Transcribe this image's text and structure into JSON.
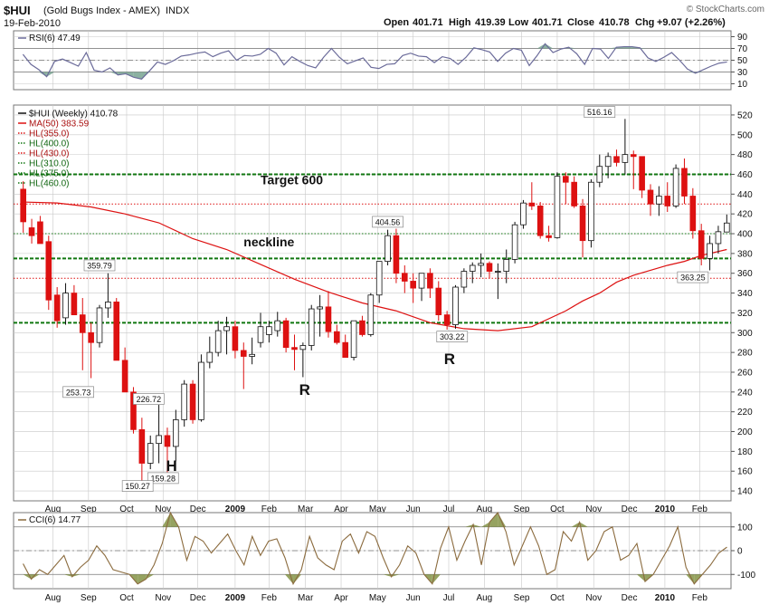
{
  "header": {
    "symbol": "$HUI",
    "name": "(Gold Bugs Index - AMEX)",
    "exchange": "INDX",
    "date": "19-Feb-2010",
    "open_label": "Open",
    "open": "401.71",
    "high_label": "High",
    "high": "419.39",
    "low_label": "Low",
    "low": "401.71",
    "close_label": "Close",
    "close": "410.78",
    "chg_label": "Chg",
    "chg": "+9.07 (+2.26%)",
    "brand": "© StockCharts.com"
  },
  "colors": {
    "up": "#ffffff",
    "down": "#dd1111",
    "ma": "#dd1111",
    "grid": "#c8c8c8",
    "osc": "#6b6b9a",
    "cci": "#8b6b3e",
    "fill": "#6e9e8a"
  },
  "chart_data": [
    {
      "type": "line",
      "title": "RSI(6) 47.49",
      "ylim": [
        0,
        100
      ],
      "yticks": [
        10,
        30,
        50,
        70,
        90
      ],
      "reference_lines": [
        30,
        50,
        70
      ],
      "x_index": [
        0,
        1,
        2,
        3,
        4,
        5,
        6,
        7,
        8,
        9,
        10,
        11,
        12,
        13,
        14,
        15,
        16,
        17,
        18,
        19,
        20,
        21,
        22,
        23,
        24,
        25,
        26,
        27,
        28,
        29,
        30,
        31,
        32,
        33,
        34,
        35,
        36,
        37,
        38,
        39,
        40,
        41,
        42,
        43,
        44,
        45,
        46,
        47,
        48,
        49,
        50,
        51,
        52,
        53,
        54,
        55,
        56,
        57,
        58,
        59,
        60,
        61,
        62,
        63,
        64,
        65,
        66,
        67,
        68,
        69,
        70,
        71,
        72,
        73,
        74,
        75,
        76,
        77,
        78,
        79,
        80,
        81,
        82,
        83,
        84,
        85,
        86,
        87,
        88,
        89
      ],
      "values": [
        60,
        43,
        34,
        22,
        48,
        52,
        46,
        40,
        63,
        33,
        30,
        37,
        25,
        27,
        21,
        18,
        32,
        47,
        43,
        49,
        57,
        59,
        62,
        64,
        56,
        62,
        66,
        50,
        58,
        57,
        60,
        70,
        62,
        42,
        56,
        48,
        41,
        37,
        55,
        70,
        55,
        44,
        49,
        54,
        38,
        36,
        43,
        44,
        58,
        62,
        57,
        56,
        46,
        56,
        53,
        43,
        55,
        71,
        68,
        64,
        48,
        62,
        70,
        67,
        41,
        58,
        78,
        63,
        69,
        72,
        61,
        43,
        70,
        69,
        53,
        72,
        73,
        73,
        71,
        54,
        48,
        55,
        63,
        50,
        35,
        28,
        34,
        40,
        45,
        47
      ]
    },
    {
      "type": "candlestick",
      "title": "$HUI (Weekly) 410.78",
      "ylim": [
        130,
        530
      ],
      "yticks": [
        140,
        160,
        180,
        200,
        220,
        240,
        260,
        280,
        300,
        320,
        340,
        360,
        380,
        400,
        420,
        440,
        460,
        480,
        500,
        520
      ],
      "x_labels": [
        "Aug",
        "Sep",
        "Oct",
        "Nov",
        "Dec",
        "2009",
        "Feb",
        "Mar",
        "Apr",
        "May",
        "Jun",
        "Jul",
        "Aug",
        "Sep",
        "Oct",
        "Nov",
        "Dec",
        "2010",
        "Feb"
      ],
      "x_label_index": [
        3.5,
        7.7,
        12.2,
        16.5,
        20.6,
        25,
        29,
        33.3,
        37.5,
        41.8,
        46,
        50.2,
        54.4,
        58.8,
        63,
        67.3,
        71.5,
        75.7,
        79.8
      ],
      "legend": [
        {
          "label": "$HUI (Weekly) 410.78",
          "color": "#111111",
          "style": "solid"
        },
        {
          "label": "MA(50) 383.59",
          "color": "#dd1111",
          "style": "solid"
        },
        {
          "label": "HL(355.0)",
          "color": "#dd1111",
          "style": "dotted"
        },
        {
          "label": "HL(400.0)",
          "color": "#117711",
          "style": "dotted"
        },
        {
          "label": "HL(430.0)",
          "color": "#dd1111",
          "style": "dotted"
        },
        {
          "label": "HL(310.0)",
          "color": "#117711",
          "style": "dotted"
        },
        {
          "label": "HL(375.0)",
          "color": "#117711",
          "style": "dotted"
        },
        {
          "label": "HL(460.0)",
          "color": "#117711",
          "style": "dotted"
        }
      ],
      "horizontal_lines": [
        {
          "value": 355,
          "color": "#dd1111",
          "width": 1
        },
        {
          "value": 400,
          "color": "#117711",
          "width": 1
        },
        {
          "value": 430,
          "color": "#dd1111",
          "width": 1
        },
        {
          "value": 310,
          "color": "#117711",
          "width": 2
        },
        {
          "value": 375,
          "color": "#117711",
          "width": 2
        },
        {
          "value": 460,
          "color": "#117711",
          "width": 2
        }
      ],
      "annotations": [
        {
          "text": "Target 600",
          "x_index": 28,
          "y": 450
        },
        {
          "text": "neckline",
          "x_index": 26,
          "y": 387
        },
        {
          "text": "H",
          "x_index": 17.5,
          "y": 160
        },
        {
          "text": "R",
          "x_index": 33.2,
          "y": 237
        },
        {
          "text": "R",
          "x_index": 50.3,
          "y": 268
        }
      ],
      "price_labels": [
        {
          "text": "359.79",
          "x_index": 9,
          "y": 368
        },
        {
          "text": "253.73",
          "x_index": 6.5,
          "y": 240
        },
        {
          "text": "226.72",
          "x_index": 14.8,
          "y": 233
        },
        {
          "text": "159.28",
          "x_index": 16.5,
          "y": 153
        },
        {
          "text": "150.27",
          "x_index": 13.5,
          "y": 145
        },
        {
          "text": "404.56",
          "x_index": 43,
          "y": 412
        },
        {
          "text": "303.22",
          "x_index": 50.6,
          "y": 296
        },
        {
          "text": "516.16",
          "x_index": 68,
          "y": 523
        },
        {
          "text": "363.25",
          "x_index": 79,
          "y": 356
        }
      ],
      "candles": [
        {
          "o": 445,
          "h": 453,
          "l": 401,
          "c": 412
        },
        {
          "o": 406,
          "h": 415,
          "l": 390,
          "c": 398
        },
        {
          "o": 412,
          "h": 418,
          "l": 395,
          "c": 390
        },
        {
          "o": 392,
          "h": 398,
          "l": 323,
          "c": 333
        },
        {
          "o": 338,
          "h": 346,
          "l": 305,
          "c": 312
        },
        {
          "o": 315,
          "h": 350,
          "l": 308,
          "c": 340
        },
        {
          "o": 340,
          "h": 348,
          "l": 320,
          "c": 318
        },
        {
          "o": 318,
          "h": 335,
          "l": 262,
          "c": 300
        },
        {
          "o": 300,
          "h": 310,
          "l": 254,
          "c": 290
        },
        {
          "o": 290,
          "h": 328,
          "l": 285,
          "c": 325
        },
        {
          "o": 325,
          "h": 360,
          "l": 315,
          "c": 331
        },
        {
          "o": 331,
          "h": 335,
          "l": 310,
          "c": 272
        },
        {
          "o": 272,
          "h": 285,
          "l": 240,
          "c": 240
        },
        {
          "o": 240,
          "h": 245,
          "l": 198,
          "c": 202
        },
        {
          "o": 202,
          "h": 214,
          "l": 150,
          "c": 168
        },
        {
          "o": 168,
          "h": 196,
          "l": 162,
          "c": 188
        },
        {
          "o": 188,
          "h": 227,
          "l": 168,
          "c": 196
        },
        {
          "o": 196,
          "h": 204,
          "l": 159,
          "c": 185
        },
        {
          "o": 185,
          "h": 222,
          "l": 170,
          "c": 212
        },
        {
          "o": 212,
          "h": 252,
          "l": 205,
          "c": 248
        },
        {
          "o": 248,
          "h": 252,
          "l": 208,
          "c": 212
        },
        {
          "o": 212,
          "h": 278,
          "l": 210,
          "c": 270
        },
        {
          "o": 270,
          "h": 296,
          "l": 264,
          "c": 280
        },
        {
          "o": 280,
          "h": 312,
          "l": 276,
          "c": 302
        },
        {
          "o": 302,
          "h": 316,
          "l": 278,
          "c": 306
        },
        {
          "o": 306,
          "h": 312,
          "l": 274,
          "c": 282
        },
        {
          "o": 282,
          "h": 290,
          "l": 243,
          "c": 276
        },
        {
          "o": 276,
          "h": 295,
          "l": 268,
          "c": 278
        },
        {
          "o": 290,
          "h": 320,
          "l": 285,
          "c": 306
        },
        {
          "o": 298,
          "h": 312,
          "l": 290,
          "c": 306
        },
        {
          "o": 302,
          "h": 321,
          "l": 296,
          "c": 312
        },
        {
          "o": 312,
          "h": 315,
          "l": 280,
          "c": 285
        },
        {
          "o": 285,
          "h": 298,
          "l": 262,
          "c": 283
        },
        {
          "o": 283,
          "h": 290,
          "l": 255,
          "c": 287
        },
        {
          "o": 287,
          "h": 328,
          "l": 282,
          "c": 324
        },
        {
          "o": 324,
          "h": 338,
          "l": 296,
          "c": 326
        },
        {
          "o": 326,
          "h": 342,
          "l": 295,
          "c": 301
        },
        {
          "o": 301,
          "h": 308,
          "l": 288,
          "c": 290
        },
        {
          "o": 290,
          "h": 298,
          "l": 275,
          "c": 275
        },
        {
          "o": 275,
          "h": 310,
          "l": 272,
          "c": 312
        },
        {
          "o": 312,
          "h": 317,
          "l": 296,
          "c": 298
        },
        {
          "o": 298,
          "h": 340,
          "l": 296,
          "c": 338
        },
        {
          "o": 338,
          "h": 372,
          "l": 330,
          "c": 372
        },
        {
          "o": 372,
          "h": 404,
          "l": 368,
          "c": 398
        },
        {
          "o": 398,
          "h": 405,
          "l": 350,
          "c": 360
        },
        {
          "o": 360,
          "h": 368,
          "l": 340,
          "c": 352
        },
        {
          "o": 352,
          "h": 360,
          "l": 330,
          "c": 345
        },
        {
          "o": 345,
          "h": 358,
          "l": 332,
          "c": 360
        },
        {
          "o": 360,
          "h": 365,
          "l": 335,
          "c": 345
        },
        {
          "o": 345,
          "h": 352,
          "l": 312,
          "c": 318
        },
        {
          "o": 318,
          "h": 322,
          "l": 303,
          "c": 308
        },
        {
          "o": 308,
          "h": 348,
          "l": 304,
          "c": 346
        },
        {
          "o": 346,
          "h": 365,
          "l": 340,
          "c": 362
        },
        {
          "o": 362,
          "h": 371,
          "l": 350,
          "c": 368
        },
        {
          "o": 368,
          "h": 380,
          "l": 356,
          "c": 370
        },
        {
          "o": 370,
          "h": 372,
          "l": 355,
          "c": 362
        },
        {
          "o": 362,
          "h": 370,
          "l": 334,
          "c": 362
        },
        {
          "o": 362,
          "h": 384,
          "l": 350,
          "c": 374
        },
        {
          "o": 374,
          "h": 412,
          "l": 370,
          "c": 409
        },
        {
          "o": 409,
          "h": 434,
          "l": 405,
          "c": 431
        },
        {
          "o": 431,
          "h": 452,
          "l": 424,
          "c": 428
        },
        {
          "o": 428,
          "h": 432,
          "l": 395,
          "c": 398
        },
        {
          "o": 398,
          "h": 408,
          "l": 392,
          "c": 396
        },
        {
          "o": 396,
          "h": 462,
          "l": 395,
          "c": 458
        },
        {
          "o": 458,
          "h": 462,
          "l": 430,
          "c": 452
        },
        {
          "o": 452,
          "h": 458,
          "l": 426,
          "c": 428
        },
        {
          "o": 428,
          "h": 435,
          "l": 376,
          "c": 393
        },
        {
          "o": 393,
          "h": 455,
          "l": 386,
          "c": 452
        },
        {
          "o": 452,
          "h": 480,
          "l": 447,
          "c": 468
        },
        {
          "o": 468,
          "h": 482,
          "l": 456,
          "c": 478
        },
        {
          "o": 478,
          "h": 485,
          "l": 468,
          "c": 472
        },
        {
          "o": 472,
          "h": 516,
          "l": 460,
          "c": 480
        },
        {
          "o": 480,
          "h": 484,
          "l": 445,
          "c": 478
        },
        {
          "o": 478,
          "h": 478,
          "l": 436,
          "c": 444
        },
        {
          "o": 444,
          "h": 450,
          "l": 418,
          "c": 430
        },
        {
          "o": 430,
          "h": 448,
          "l": 418,
          "c": 438
        },
        {
          "o": 438,
          "h": 452,
          "l": 422,
          "c": 428
        },
        {
          "o": 428,
          "h": 470,
          "l": 426,
          "c": 466
        },
        {
          "o": 466,
          "h": 476,
          "l": 430,
          "c": 438
        },
        {
          "o": 438,
          "h": 446,
          "l": 395,
          "c": 403
        },
        {
          "o": 403,
          "h": 410,
          "l": 368,
          "c": 375
        },
        {
          "o": 375,
          "h": 398,
          "l": 363,
          "c": 390
        },
        {
          "o": 390,
          "h": 408,
          "l": 380,
          "c": 402
        },
        {
          "o": 401.71,
          "h": 419.39,
          "l": 401.71,
          "c": 410.78
        }
      ],
      "ma_series": {
        "name": "MA(50)",
        "x_index": [
          0,
          4,
          8,
          12,
          16,
          20,
          24,
          28,
          32,
          36,
          40,
          44,
          48,
          52,
          56,
          60,
          64,
          66,
          68,
          70,
          72,
          74,
          76,
          78,
          80,
          83
        ],
        "values": [
          432,
          431,
          427,
          420,
          411,
          395,
          384,
          369,
          354,
          341,
          330,
          322,
          310,
          304,
          302,
          306,
          322,
          332,
          340,
          351,
          358,
          363,
          368,
          372,
          378,
          384
        ]
      }
    },
    {
      "type": "line",
      "title": "CCI(6) 14.77",
      "ylim": [
        -160,
        160
      ],
      "yticks": [
        -100,
        0,
        100
      ],
      "reference_lines": [
        -100,
        0,
        100
      ],
      "values": [
        -55,
        -120,
        -80,
        -100,
        -60,
        -20,
        -110,
        -70,
        -40,
        20,
        -20,
        -80,
        -90,
        -100,
        -140,
        -120,
        -60,
        30,
        160,
        100,
        -40,
        60,
        40,
        -10,
        30,
        70,
        0,
        -60,
        60,
        -20,
        40,
        50,
        -30,
        -140,
        -80,
        60,
        -30,
        -60,
        -80,
        40,
        70,
        -10,
        80,
        60,
        -30,
        -110,
        -60,
        20,
        -10,
        -100,
        -140,
        10,
        100,
        -40,
        40,
        110,
        -60,
        120,
        160,
        80,
        -60,
        20,
        100,
        20,
        -100,
        -80,
        80,
        40,
        120,
        -40,
        0,
        80,
        100,
        -40,
        -20,
        30,
        -130,
        -100,
        -40,
        20,
        100,
        -70,
        -140,
        -100,
        -60,
        -10,
        14.77
      ]
    }
  ]
}
